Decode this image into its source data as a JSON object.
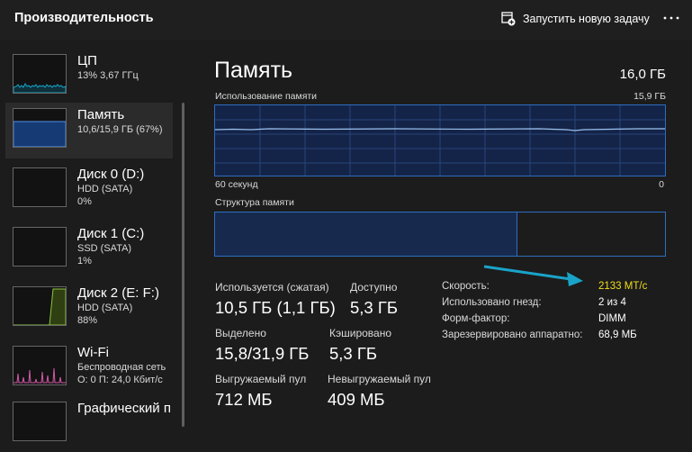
{
  "header": {
    "title": "Производительность",
    "run_task_label": "Запустить новую задачу"
  },
  "sidebar": {
    "items": [
      {
        "name": "ЦП",
        "sub1": "13% 3,67 ГГц",
        "sub2": ""
      },
      {
        "name": "Память",
        "sub1": "10,6/15,9 ГБ (67%)",
        "sub2": ""
      },
      {
        "name": "Диск 0 (D:)",
        "sub1": "HDD (SATA)",
        "sub2": "0%"
      },
      {
        "name": "Диск 1 (C:)",
        "sub1": "SSD (SATA)",
        "sub2": "1%"
      },
      {
        "name": "Диск 2 (E: F:)",
        "sub1": "HDD (SATA)",
        "sub2": "88%"
      },
      {
        "name": "Wi-Fi",
        "sub1": "Беспроводная сеть",
        "sub2": "О: 0 П: 24,0 Кбит/с"
      },
      {
        "name": "Графический п",
        "sub1": "",
        "sub2": ""
      }
    ]
  },
  "memory": {
    "title": "Память",
    "total": "16,0 ГБ",
    "usage_label": "Использование памяти",
    "usage_max": "15,9 ГБ",
    "time_label": "60 секунд",
    "time_end": "0",
    "structure_label": "Структура памяти",
    "stats": {
      "in_use_label": "Используется (сжатая)",
      "in_use_value": "10,5 ГБ (1,1 ГБ)",
      "available_label": "Доступно",
      "available_value": "5,3 ГБ",
      "committed_label": "Выделено",
      "committed_value": "15,8/31,9 ГБ",
      "cached_label": "Кэшировано",
      "cached_value": "5,3 ГБ",
      "paged_label": "Выгружаемый пул",
      "paged_value": "712 МБ",
      "nonpaged_label": "Невыгружаемый пул",
      "nonpaged_value": "409 МБ"
    },
    "details": [
      {
        "label": "Скорость:",
        "value": "2133 МТ/с"
      },
      {
        "label": "Использовано гнезд:",
        "value": "2 из 4"
      },
      {
        "label": "Форм-фактор:",
        "value": "DIMM"
      },
      {
        "label": "Зарезервировано аппаратно:",
        "value": "68,9 МБ"
      }
    ],
    "usage_fraction": 0.67
  },
  "colors": {
    "memory_accent": "#2c6ec2",
    "highlight": "#f2dd1e",
    "annotation_arrow": "#1aa3c8"
  },
  "icons": {
    "run_task": "new-task-icon",
    "more": "more-options-icon"
  }
}
